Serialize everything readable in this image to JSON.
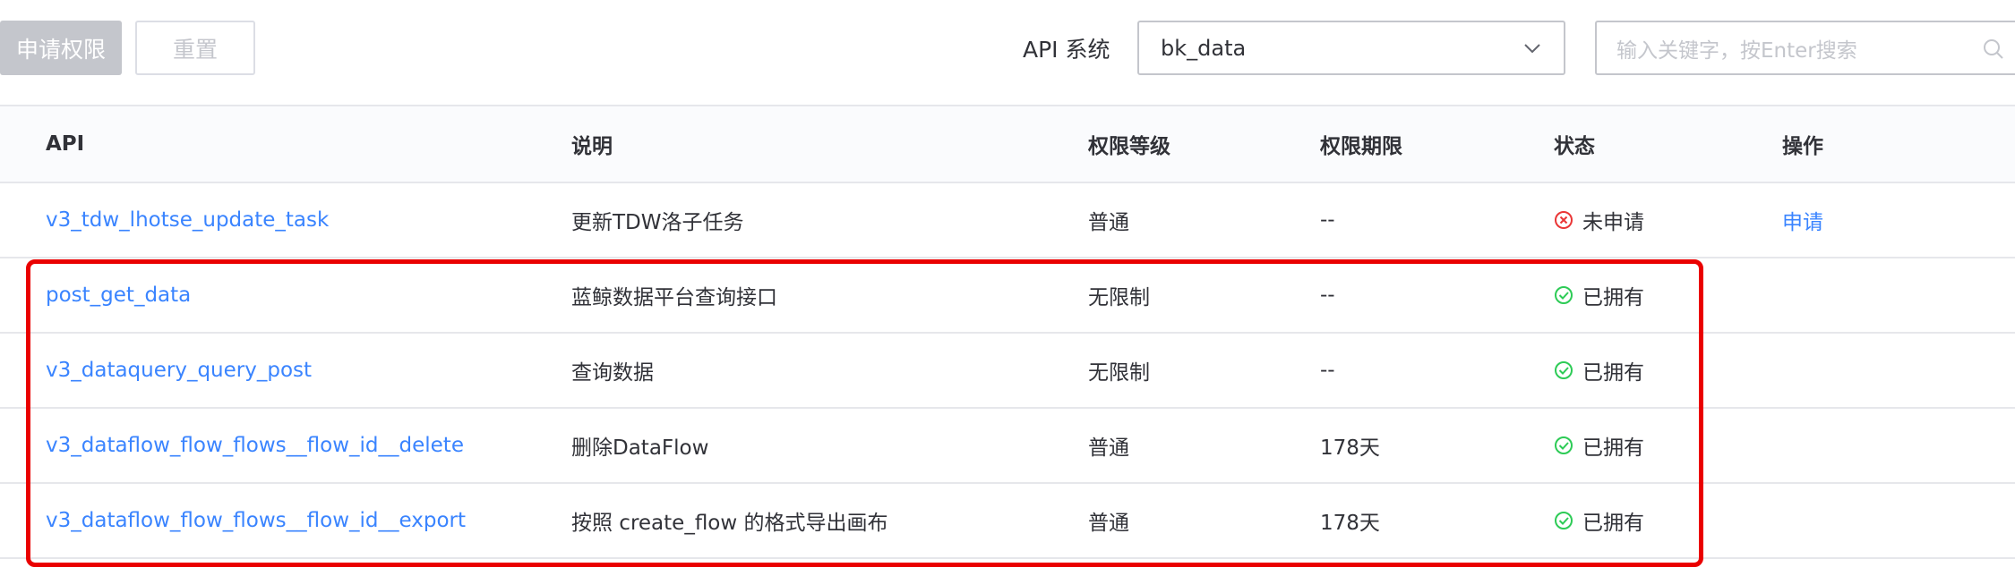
{
  "toolbar": {
    "apply_label": "申请权限",
    "reset_label": "重置",
    "system_label": "API 系统",
    "system_value": "bk_data",
    "search_placeholder": "输入关键字，按Enter搜索"
  },
  "table": {
    "headers": {
      "api": "API",
      "desc": "说明",
      "level": "权限等级",
      "term": "权限期限",
      "status": "状态",
      "op": "操作"
    },
    "rows": [
      {
        "api": "v3_tdw_lhotse_update_task",
        "desc": "更新TDW洛子任务",
        "level": "普通",
        "term": "--",
        "status": "未申请",
        "status_type": "not-applied",
        "op": "申请"
      },
      {
        "api": "post_get_data",
        "desc": "蓝鲸数据平台查询接口",
        "level": "无限制",
        "term": "--",
        "status": "已拥有",
        "status_type": "owned",
        "op": ""
      },
      {
        "api": "v3_dataquery_query_post",
        "desc": "查询数据",
        "level": "无限制",
        "term": "--",
        "status": "已拥有",
        "status_type": "owned",
        "op": ""
      },
      {
        "api": "v3_dataflow_flow_flows__flow_id__delete",
        "desc": "删除DataFlow",
        "level": "普通",
        "term": "178天",
        "status": "已拥有",
        "status_type": "owned",
        "op": ""
      },
      {
        "api": "v3_dataflow_flow_flows__flow_id__export",
        "desc": "按照 create_flow 的格式导出画布",
        "level": "普通",
        "term": "178天",
        "status": "已拥有",
        "status_type": "owned",
        "op": ""
      }
    ]
  },
  "colors": {
    "link": "#3a84ff",
    "owned": "#2dcb56",
    "not_applied": "#ea3636",
    "highlight": "#ea0000"
  },
  "icons": {
    "select_arrow": "chevron-down-icon",
    "search": "search-icon",
    "owned": "check-circle-icon",
    "not_applied": "close-circle-icon"
  }
}
